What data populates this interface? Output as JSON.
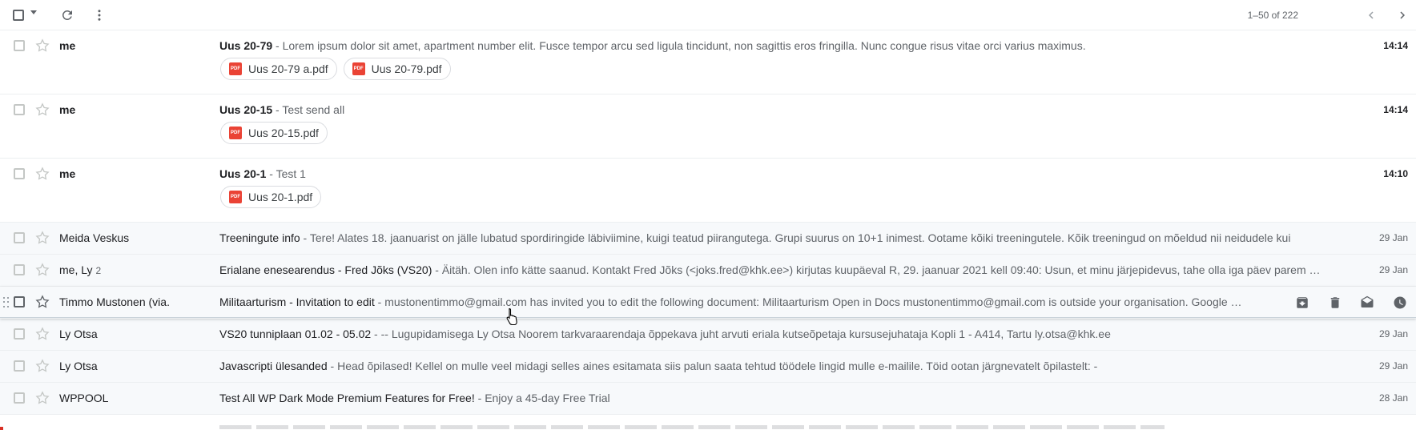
{
  "toolbar": {
    "range": "1–50 of 222",
    "icons": [
      "select-all-checkbox",
      "select-dropdown-caret",
      "refresh-icon",
      "more-vert-icon",
      "chevron-left-icon",
      "chevron-right-icon"
    ]
  },
  "emails": [
    {
      "sender": "me",
      "subject": "Uus 20-79",
      "snippet": "Lorem ipsum dolor sit amet, apartment number elit. Fusce tempor arcu sed ligula tincidunt, non sagittis eros fringilla. Nunc congue risus vitae orci varius maximus.",
      "date": "14:14",
      "attachments": [
        "Uus 20-79 a.pdf",
        "Uus 20-79.pdf"
      ]
    },
    {
      "sender": "me",
      "subject": "Uus 20-15",
      "snippet": "Test send all",
      "date": "14:14",
      "attachments": [
        "Uus 20-15.pdf"
      ]
    },
    {
      "sender": "me",
      "subject": "Uus 20-1",
      "snippet": "Test 1",
      "date": "14:10",
      "attachments": [
        "Uus 20-1.pdf"
      ]
    },
    {
      "sender": "Meida Veskus",
      "subject": "Treeningute info",
      "snippet": "Tere! Alates 18. jaanuarist on jälle lubatud spordiringide läbiviimine, kuigi teatud piirangutega. Grupi suurus on 10+1 inimest. Ootame kõiki treeningutele. Kõik treeningud on mõeldud nii neidudele kui",
      "date": "29 Jan"
    },
    {
      "sender": "me, Ly",
      "count": "2",
      "subject": "Erialane enesearendus - Fred Jõks (VS20)",
      "snippet": "Äitäh. Olen info kätte saanud. Kontakt Fred Jõks (<joks.fred@khk.ee>) kirjutas kuupäeval R, 29. jaanuar 2021 kell 09:40: Usun, et minu järjepidevus, tahe olla iga päev parem …",
      "date": "29 Jan"
    },
    {
      "sender": "Timmo Mustonen (via.",
      "subject": "Militaarturism - Invitation to edit",
      "snippet": "mustonentimmo@gmail.com has invited you to edit the following document: Militaarturism Open in Docs mustonentimmo@gmail.com is outside your organisation. Google …",
      "hover_actions": [
        "archive-icon",
        "delete-icon",
        "mark-as-read-icon",
        "snooze-icon"
      ]
    },
    {
      "sender": "Ly Otsa",
      "subject": "VS20 tunniplaan 01.02 - 05.02",
      "snippet": "-- Lugupidamisega Ly Otsa Noorem tarkvaraarendaja õppekava juht arvuti eriala kutseõpetaja kursusejuhataja Kopli 1 - A414, Tartu ly.otsa@khk.ee",
      "date": "29 Jan"
    },
    {
      "sender": "Ly Otsa",
      "subject": "Javascripti ülesanded",
      "snippet": "Head õpilased! Kellel on mulle veel midagi selles aines esitamata siis palun saata tehtud töödele lingid mulle e-mailile. Töid ootan järgnevatelt õpilastelt: -",
      "date": "29 Jan"
    },
    {
      "sender": "WPPOOL",
      "subject": "Test All WP Dark Mode Premium Features for Free!",
      "snippet": "Enjoy a 45-day Free Trial",
      "date": "28 Jan"
    }
  ],
  "separator": " - ",
  "pdf_badge": "PDF",
  "colors": {
    "pdf_red": "#ea4335",
    "unread_bg": "#ffffff",
    "read_bg": "#f7f9fb",
    "divider": "#eceff1"
  }
}
